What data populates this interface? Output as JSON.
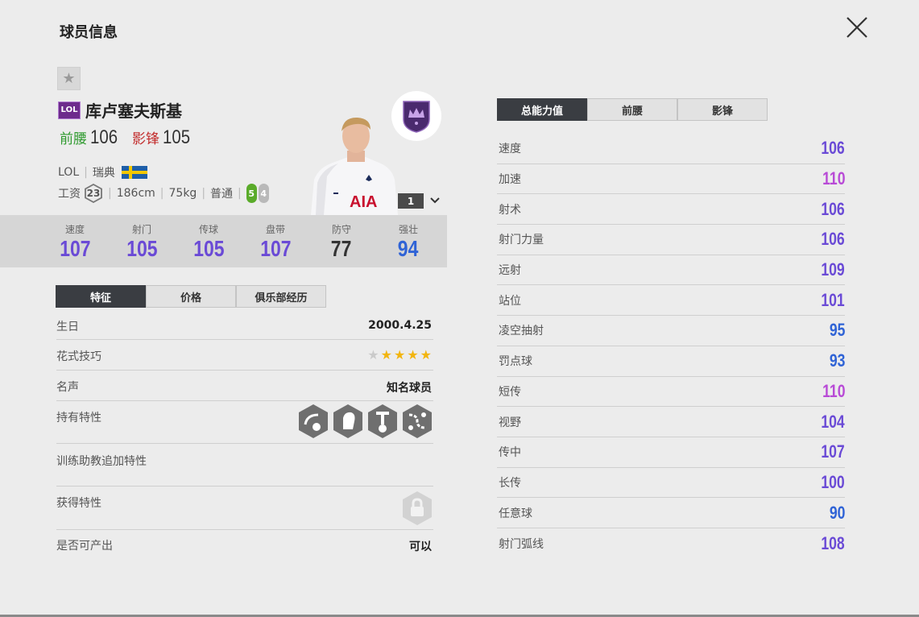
{
  "header": {
    "title": "球员信息"
  },
  "player": {
    "season_badge": "LOL",
    "name": "库卢塞夫斯基",
    "positions": [
      {
        "name": "前腰",
        "value": "106"
      },
      {
        "name": "影锋",
        "value": "105"
      }
    ],
    "season": "LOL",
    "nation": "瑞典",
    "salary_label": "工资",
    "salary": "23",
    "height": "186cm",
    "weight": "75kg",
    "body_type": "普通",
    "weak_foot_left": "5",
    "weak_foot_right": "4",
    "level": "1"
  },
  "summary_stats": [
    {
      "label": "速度",
      "value": "107",
      "color": "#6a4ad6"
    },
    {
      "label": "射门",
      "value": "105",
      "color": "#6a4ad6"
    },
    {
      "label": "传球",
      "value": "105",
      "color": "#6a4ad6"
    },
    {
      "label": "盘带",
      "value": "107",
      "color": "#6a4ad6"
    },
    {
      "label": "防守",
      "value": "77",
      "color": "#333333"
    },
    {
      "label": "强壮",
      "value": "94",
      "color": "#2f63d6"
    }
  ],
  "left_tabs": [
    {
      "label": "特征",
      "active": true
    },
    {
      "label": "价格",
      "active": false
    },
    {
      "label": "俱乐部经历",
      "active": false
    }
  ],
  "info": {
    "birthday_label": "生日",
    "birthday": "2000.4.25",
    "skill_label": "花式技巧",
    "skill_stars": 4,
    "fame_label": "名声",
    "fame": "知名球员",
    "traits_label": "持有特性",
    "coach_label": "训练助教追加特性",
    "acquired_label": "获得特性",
    "producible_label": "是否可产出",
    "producible": "可以"
  },
  "trait_icons": [
    "outside-curl-trait-icon",
    "speed-dribbler-trait-icon",
    "long-shot-taker-trait-icon",
    "playmaker-trait-icon"
  ],
  "right_tabs": [
    {
      "label": "总能力值",
      "active": true
    },
    {
      "label": "前腰",
      "active": false
    },
    {
      "label": "影锋",
      "active": false
    }
  ],
  "attributes": [
    {
      "name": "速度",
      "value": "106",
      "color": "#6a4ad6"
    },
    {
      "name": "加速",
      "value": "110",
      "color": "#b84ad6"
    },
    {
      "name": "射术",
      "value": "106",
      "color": "#6a4ad6"
    },
    {
      "name": "射门力量",
      "value": "106",
      "color": "#6a4ad6"
    },
    {
      "name": "远射",
      "value": "109",
      "color": "#6a4ad6"
    },
    {
      "name": "站位",
      "value": "101",
      "color": "#6a4ad6"
    },
    {
      "name": "凌空抽射",
      "value": "95",
      "color": "#2f63d6"
    },
    {
      "name": "罚点球",
      "value": "93",
      "color": "#2f63d6"
    },
    {
      "name": "短传",
      "value": "110",
      "color": "#b84ad6"
    },
    {
      "name": "视野",
      "value": "104",
      "color": "#6a4ad6"
    },
    {
      "name": "传中",
      "value": "107",
      "color": "#6a4ad6"
    },
    {
      "name": "长传",
      "value": "100",
      "color": "#6a4ad6"
    },
    {
      "name": "任意球",
      "value": "90",
      "color": "#2f63d6"
    },
    {
      "name": "射门弧线",
      "value": "108",
      "color": "#6a4ad6"
    }
  ],
  "shirt_sponsor": "AIA"
}
